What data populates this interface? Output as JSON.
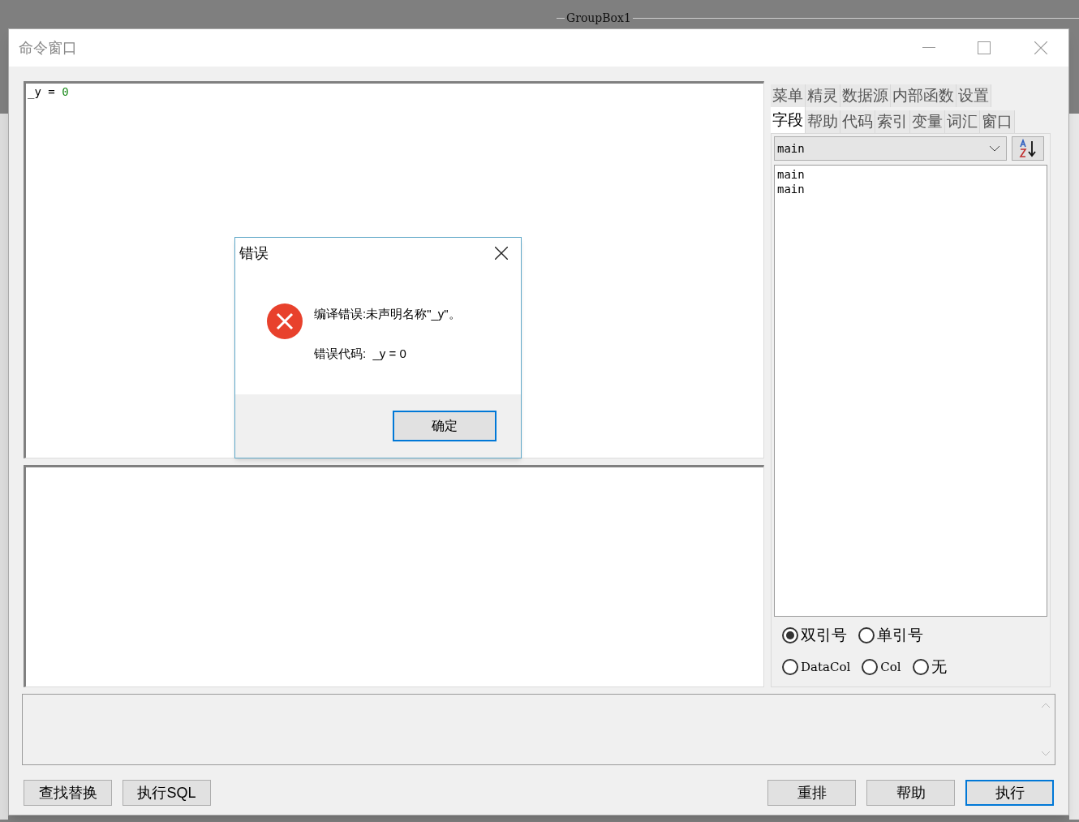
{
  "background": {
    "groupbox_label": "GroupBox1"
  },
  "window": {
    "title": "命令窗口"
  },
  "editor": {
    "tokens": [
      {
        "text": "_y = ",
        "kind": "plain"
      },
      {
        "text": "0",
        "kind": "number"
      }
    ]
  },
  "side_panel": {
    "tab_rows": [
      [
        {
          "label": "菜单",
          "selected": false
        },
        {
          "label": "精灵",
          "selected": false
        },
        {
          "label": "数据源",
          "selected": false
        },
        {
          "label": "内部函数",
          "selected": false
        },
        {
          "label": "设置",
          "selected": false
        }
      ],
      [
        {
          "label": "字段",
          "selected": true
        },
        {
          "label": "帮助",
          "selected": false
        },
        {
          "label": "代码",
          "selected": false
        },
        {
          "label": "索引",
          "selected": false
        },
        {
          "label": "变量",
          "selected": false
        },
        {
          "label": "词汇",
          "selected": false
        },
        {
          "label": "窗口",
          "selected": false
        }
      ]
    ],
    "dropdown": {
      "value": "main"
    },
    "list_items": [
      "main",
      "main"
    ],
    "radio_rows": [
      [
        {
          "label": "双引号",
          "selected": true,
          "kind": "cjk"
        },
        {
          "label": "单引号",
          "selected": false,
          "kind": "cjk"
        }
      ],
      [
        {
          "label": "DataCol",
          "selected": false,
          "kind": "latin"
        },
        {
          "label": "Col",
          "selected": false,
          "kind": "latin"
        },
        {
          "label": "无",
          "selected": false,
          "kind": "cjk"
        }
      ]
    ]
  },
  "left_buttons": [
    {
      "label": "查找替换",
      "default": false
    },
    {
      "label": "执行SQL",
      "default": false
    }
  ],
  "right_buttons": [
    {
      "label": "重排",
      "default": false
    },
    {
      "label": "帮助",
      "default": false
    },
    {
      "label": "执行",
      "default": true
    }
  ],
  "dialog": {
    "title": "错误",
    "message": "编译错误:未声明名称\"_y\"。",
    "code_line": "错误代码:  _y = 0",
    "ok_button": "确定"
  }
}
